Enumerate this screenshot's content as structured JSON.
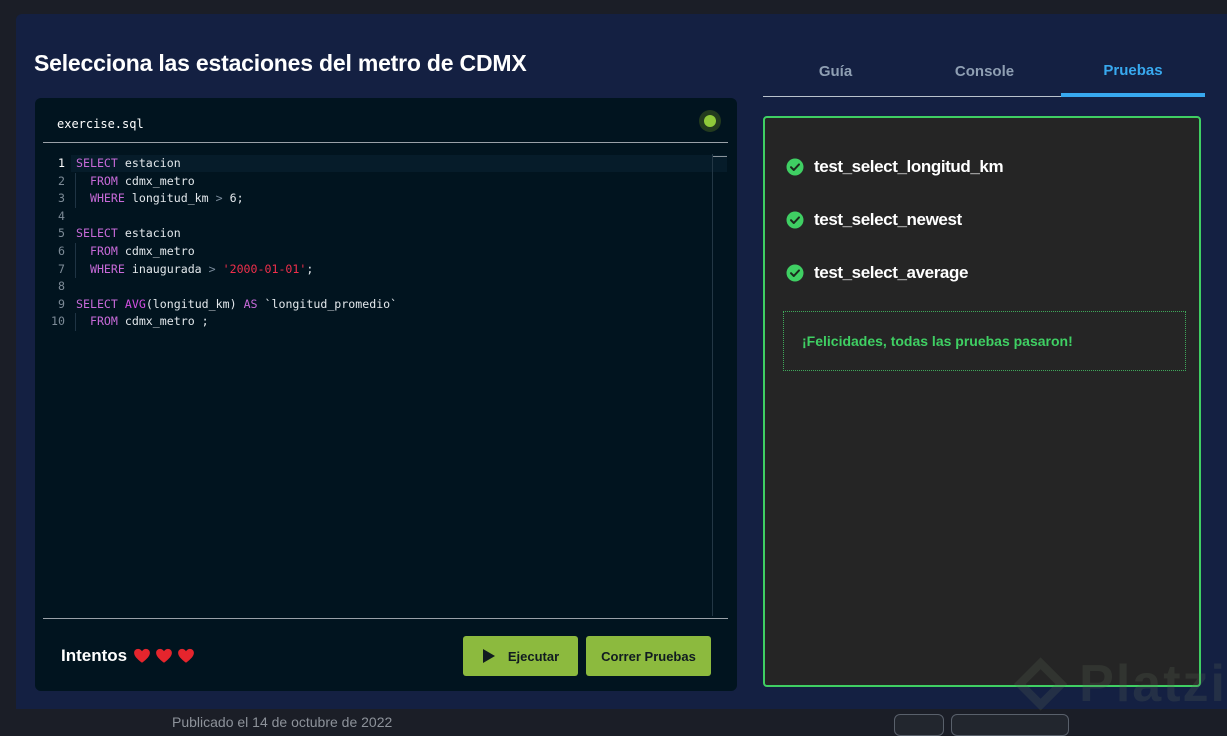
{
  "exercise": {
    "title": "Selecciona las estaciones del metro de CDMX"
  },
  "editor": {
    "file_name": "exercise.sql",
    "status_color": "#8fc93a",
    "lines": [
      {
        "num": "1",
        "tokens": [
          [
            "kw",
            "SELECT"
          ],
          [
            "id",
            " estacion"
          ]
        ]
      },
      {
        "num": "2",
        "tokens": [
          [
            "kw",
            "  FROM"
          ],
          [
            "id",
            " cdmx_metro"
          ]
        ]
      },
      {
        "num": "3",
        "tokens": [
          [
            "kw",
            "  WHERE"
          ],
          [
            "id",
            " longitud_km "
          ],
          [
            "op",
            ">"
          ],
          [
            "id",
            " 6;"
          ]
        ]
      },
      {
        "num": "4",
        "tokens": []
      },
      {
        "num": "5",
        "tokens": [
          [
            "kw",
            "SELECT"
          ],
          [
            "id",
            " estacion"
          ]
        ]
      },
      {
        "num": "6",
        "tokens": [
          [
            "kw",
            "  FROM"
          ],
          [
            "id",
            " cdmx_metro"
          ]
        ]
      },
      {
        "num": "7",
        "tokens": [
          [
            "kw",
            "  WHERE"
          ],
          [
            "id",
            " inaugurada "
          ],
          [
            "op",
            ">"
          ],
          [
            "id",
            " "
          ],
          [
            "str",
            "'2000-01-01'"
          ],
          [
            "id",
            ";"
          ]
        ]
      },
      {
        "num": "8",
        "tokens": []
      },
      {
        "num": "9",
        "tokens": [
          [
            "kw",
            "SELECT "
          ],
          [
            "fn",
            "AVG"
          ],
          [
            "id",
            "(longitud_km) "
          ],
          [
            "kw",
            "AS"
          ],
          [
            "id",
            " `longitud_promedio`"
          ]
        ]
      },
      {
        "num": "10",
        "tokens": [
          [
            "kw",
            "  FROM"
          ],
          [
            "id",
            " cdmx_metro ;"
          ]
        ]
      }
    ]
  },
  "footer": {
    "attempts_label": "Intentos",
    "hearts": 3,
    "run_label": "Ejecutar",
    "tests_label": "Correr Pruebas"
  },
  "tabs": [
    {
      "label": "Guía",
      "active": false
    },
    {
      "label": "Console",
      "active": false
    },
    {
      "label": "Pruebas",
      "active": true
    }
  ],
  "results": {
    "tests": [
      {
        "name": "test_select_longitud_km",
        "status": "passed"
      },
      {
        "name": "test_select_newest",
        "status": "passed"
      },
      {
        "name": "test_select_average",
        "status": "passed"
      }
    ],
    "message": "¡Felicidades, todas las pruebas pasaron!"
  },
  "watermark": {
    "text": "Platzi"
  },
  "page_footer": {
    "published": "Publicado el 14 de octubre de 2022"
  },
  "colors": {
    "accent_green": "#8cba3e",
    "success_green": "#3fcf63",
    "tab_active": "#38a9ef",
    "heart_red": "#e5252d"
  }
}
